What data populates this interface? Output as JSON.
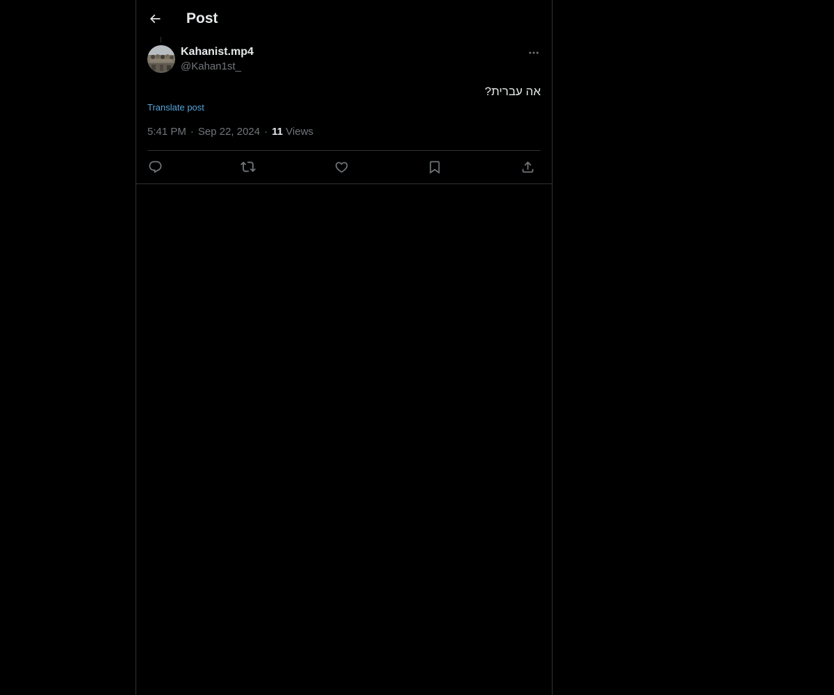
{
  "header": {
    "title": "Post",
    "back_icon": "arrow-left-icon"
  },
  "post": {
    "author": {
      "display_name": "Kahanist.mp4",
      "handle": "@Kahan1st_",
      "avatar_icon": "avatar-image"
    },
    "more_icon": "more-horizontal-icon",
    "text": "אה עברית?",
    "translate_label": "Translate post",
    "time": "5:41 PM",
    "date": "Sep 22, 2024",
    "views_count": "11",
    "views_label": "Views",
    "separator": "·"
  },
  "actions": [
    {
      "name": "reply",
      "icon": "reply-icon"
    },
    {
      "name": "repost",
      "icon": "repost-icon"
    },
    {
      "name": "like",
      "icon": "heart-icon"
    },
    {
      "name": "bookmark",
      "icon": "bookmark-icon"
    },
    {
      "name": "share",
      "icon": "share-icon"
    }
  ],
  "colors": {
    "background": "#000000",
    "border": "#2f3336",
    "text_primary": "#e7e9ea",
    "text_secondary": "#71767b",
    "link": "#1d9bf0"
  }
}
